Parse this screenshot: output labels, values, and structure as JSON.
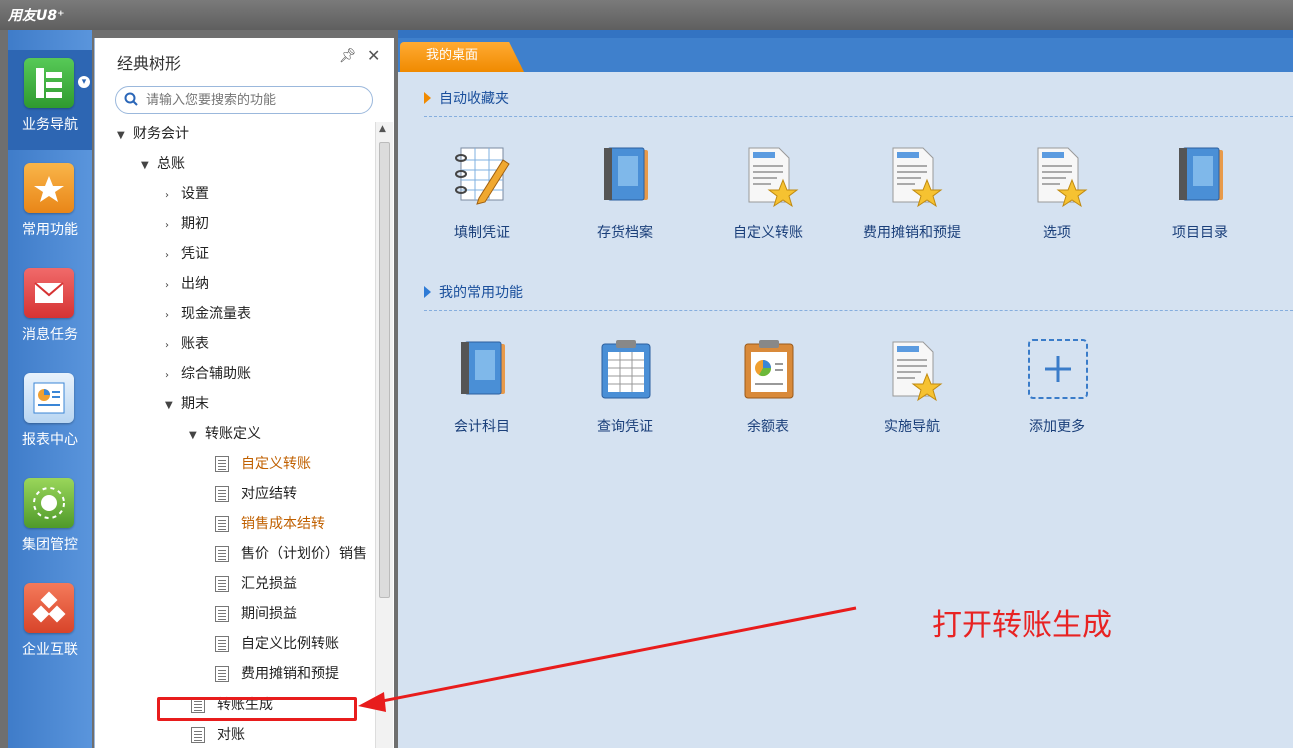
{
  "app": {
    "brand": "用友U8⁺"
  },
  "leftnav": [
    {
      "label": "业务导航",
      "icon": "business-nav-icon",
      "color": "#3bb03b"
    },
    {
      "label": "常用功能",
      "icon": "star-folder-icon",
      "color": "#f39a2a"
    },
    {
      "label": "消息任务",
      "icon": "mail-icon",
      "color": "#e84b4b"
    },
    {
      "label": "报表中心",
      "icon": "report-icon",
      "color": "#3a86d6"
    },
    {
      "label": "集团管控",
      "icon": "group-control-icon",
      "color": "#5fb83a"
    },
    {
      "label": "企业互联",
      "icon": "enterprise-link-icon",
      "color": "#e8503a"
    }
  ],
  "tree": {
    "title": "经典树形",
    "search_placeholder": "请输入您要搜索的功能",
    "nodes": [
      {
        "label": "财务会计"
      },
      {
        "label": "总账"
      },
      {
        "label": "设置"
      },
      {
        "label": "期初"
      },
      {
        "label": "凭证"
      },
      {
        "label": "出纳"
      },
      {
        "label": "现金流量表"
      },
      {
        "label": "账表"
      },
      {
        "label": "综合辅助账"
      },
      {
        "label": "期末"
      },
      {
        "label": "转账定义"
      },
      {
        "label": "自定义转账"
      },
      {
        "label": "对应结转"
      },
      {
        "label": "销售成本结转"
      },
      {
        "label": "售价（计划价）销售"
      },
      {
        "label": "汇兑损益"
      },
      {
        "label": "期间损益"
      },
      {
        "label": "自定义比例转账"
      },
      {
        "label": "费用摊销和预提"
      },
      {
        "label": "转账生成"
      },
      {
        "label": "对账"
      }
    ]
  },
  "main": {
    "tab_label": "我的桌面",
    "sections": [
      {
        "title": "自动收藏夹",
        "tiles": [
          {
            "label": "填制凭证",
            "icon": "fill-voucher-icon"
          },
          {
            "label": "存货档案",
            "icon": "book-icon"
          },
          {
            "label": "自定义转账",
            "icon": "doc-star-icon"
          },
          {
            "label": "费用摊销和预提",
            "icon": "doc-star-icon"
          },
          {
            "label": "选项",
            "icon": "doc-star-icon"
          },
          {
            "label": "项目目录",
            "icon": "book-icon"
          }
        ]
      },
      {
        "title": "我的常用功能",
        "tiles": [
          {
            "label": "会计科目",
            "icon": "book-icon"
          },
          {
            "label": "查询凭证",
            "icon": "clipboard-table-icon"
          },
          {
            "label": "余额表",
            "icon": "clipboard-chart-icon"
          },
          {
            "label": "实施导航",
            "icon": "doc-star-icon"
          },
          {
            "label": "添加更多",
            "icon": "plus-icon"
          }
        ]
      }
    ]
  },
  "annotation": {
    "text": "打开转账生成"
  }
}
